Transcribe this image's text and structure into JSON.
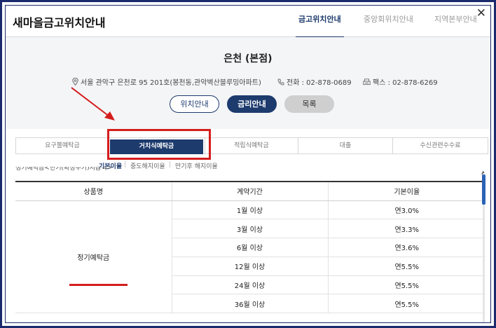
{
  "header": {
    "title": "새마을금고위치안내",
    "tabs": [
      {
        "label": "금고위치안내",
        "active": true
      },
      {
        "label": "중앙회위치안내",
        "active": false
      },
      {
        "label": "지역본부안내",
        "active": false
      }
    ],
    "close_label": "✕"
  },
  "branch": {
    "name": "은천 (본점)",
    "address": "서울 관악구 은천로 95 201호(봉천동,관악벽산블루밍아파트)",
    "phone": "전화 : 02-878-0689",
    "fax": "팩스 : 02-878-6269",
    "buttons": {
      "location": "위치안내",
      "rate": "금리안내",
      "list": "목록"
    }
  },
  "product_tabs": [
    "요구불예탁금",
    "거치식예탁금",
    "적립식예탁금",
    "대출",
    "수신관련수수료"
  ],
  "active_product_tab": 1,
  "sub_tabs": [
    "기본이율",
    "중도해지이율",
    "만기후 해지이율"
  ],
  "caption": "정기예탁금<단기(확정주기)지급식>",
  "table": {
    "headers": [
      "상품명",
      "계약기간",
      "기본이율"
    ],
    "product": "정기예탁금",
    "rows": [
      {
        "term": "1월 이상",
        "rate": "연3.0%"
      },
      {
        "term": "3월 이상",
        "rate": "연3.3%"
      },
      {
        "term": "6월 이상",
        "rate": "연3.6%"
      },
      {
        "term": "12월 이상",
        "rate": "연5.5%"
      },
      {
        "term": "24월 이상",
        "rate": "연5.5%"
      },
      {
        "term": "36월 이상",
        "rate": "연5.5%"
      }
    ]
  },
  "colors": {
    "brand": "#1d3b6d",
    "highlight": "#d51d1d",
    "scroll": "#2a63b4"
  },
  "icons": [
    "location-pin-icon",
    "phone-icon",
    "fax-icon",
    "close-icon"
  ]
}
